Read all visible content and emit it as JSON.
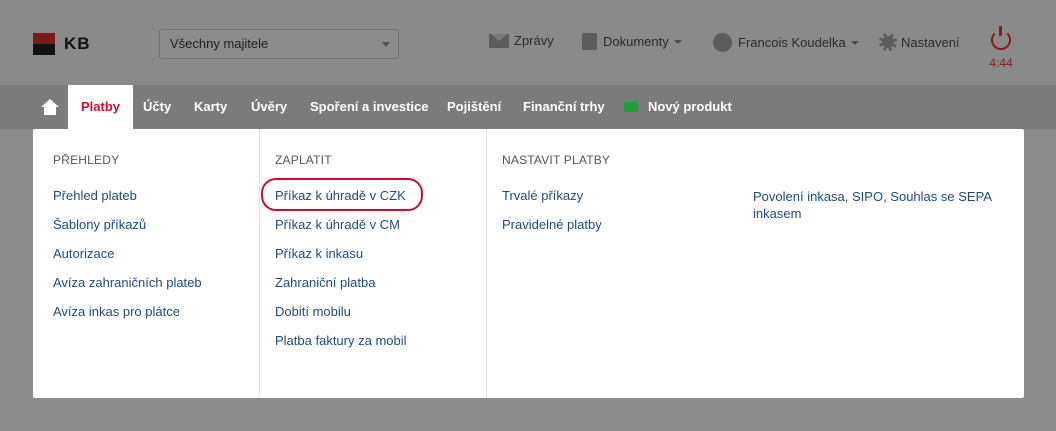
{
  "header": {
    "logo_text": "KB",
    "owner_select": "Všechny majitele",
    "messages": "Zprávy",
    "documents": "Dokumenty",
    "user": "Francois Koudelka",
    "settings": "Nastavení",
    "session_time": "4:44",
    "colors": {
      "accent": "#c8102e",
      "logo_red": "#7a1a18"
    }
  },
  "nav": {
    "tabs": [
      "Platby",
      "Účty",
      "Karty",
      "Úvěry",
      "Spoření a investice",
      "Pojištění",
      "Finanční trhy",
      "Nový produkt"
    ]
  },
  "menu": {
    "columns": [
      {
        "heading": "PŘEHLEDY",
        "items": [
          "Přehled plateb",
          "Šablony příkazů",
          "Autorizace",
          "Avíza zahraničních plateb",
          "Avíza inkas pro plátce"
        ]
      },
      {
        "heading": "ZAPLATIT",
        "items": [
          "Příkaz k úhradě v CZK",
          "Příkaz k úhradě v CM",
          "Příkaz k inkasu",
          "Zahraniční platba",
          "Dobití mobilu",
          "Platba faktury za mobil"
        ]
      },
      {
        "heading": "NASTAVIT PLATBY",
        "items": [
          "Trvalé příkazy",
          "Pravidelné platby"
        ]
      },
      {
        "heading": "",
        "items": [
          "Povolení inkasa, SIPO, Souhlas se SEPA inkasem"
        ]
      }
    ]
  }
}
